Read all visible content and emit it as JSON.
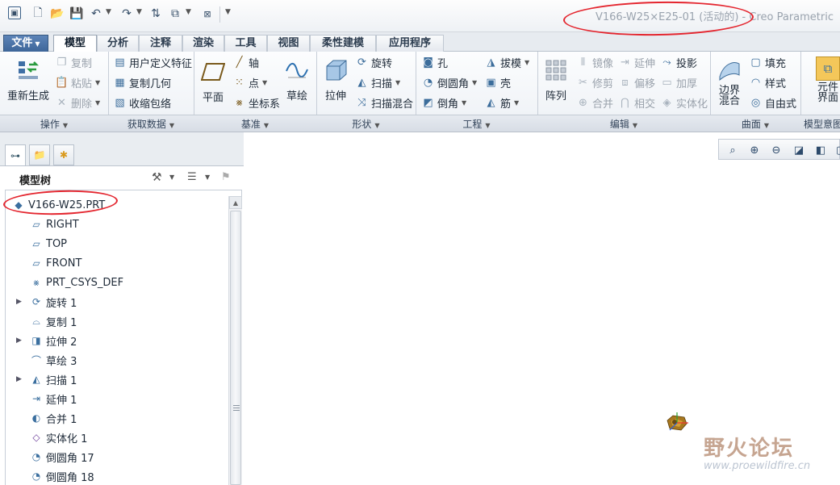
{
  "window": {
    "title": "V166-W25×E25-01 (活动的) - Creo Parametric"
  },
  "tabs": [
    {
      "label": "文件",
      "has_dropdown": true
    },
    {
      "label": "模型",
      "active": true
    },
    {
      "label": "分析"
    },
    {
      "label": "注释"
    },
    {
      "label": "渲染"
    },
    {
      "label": "工具"
    },
    {
      "label": "视图"
    },
    {
      "label": "柔性建模"
    },
    {
      "label": "应用程序"
    }
  ],
  "ribbon": {
    "ops": {
      "regen": "重新生成",
      "copy": "复制",
      "paste": "粘贴",
      "delete": "删除"
    },
    "getdata": {
      "udf": "用户定义特征",
      "copy_geom": "复制几何",
      "shrinkwrap": "收缩包络"
    },
    "datum": {
      "plane": "平面",
      "axis": "轴",
      "point": "点",
      "csys": "坐标系",
      "sketch": "草绘"
    },
    "shape": {
      "extrude": "拉伸",
      "revolve": "旋转",
      "sweep": "扫描",
      "swept_blend": "扫描混合"
    },
    "eng": {
      "hole": "孔",
      "round": "倒圆角",
      "chamfer": "倒角",
      "draft": "拔模",
      "shell": "壳",
      "rib": "筋"
    },
    "edit": {
      "pattern": "阵列",
      "mirror": "镜像",
      "trim": "修剪",
      "merge": "合并",
      "extend": "延伸",
      "offset": "偏移",
      "intersect": "相交",
      "project": "投影",
      "thicken": "加厚",
      "solidify": "实体化"
    },
    "surface": {
      "boundary_line1": "边界",
      "boundary_line2": "混合",
      "fill": "填充",
      "style": "样式",
      "freestyle": "自由式"
    },
    "intent": {
      "component_line1": "元件",
      "component_line2": "界面"
    }
  },
  "groups": {
    "ops": "操作",
    "getdata": "获取数据",
    "datum": "基准",
    "shape": "形状",
    "eng": "工程",
    "edit": "编辑",
    "surface": "曲面",
    "intent": "模型意图"
  },
  "tree": {
    "title": "模型树",
    "items": [
      {
        "label": "V166-W25.PRT",
        "icon": "part-icon",
        "expandable": false
      },
      {
        "label": "RIGHT",
        "icon": "datum-plane-icon",
        "expandable": false
      },
      {
        "label": "TOP",
        "icon": "datum-plane-icon",
        "expandable": false
      },
      {
        "label": "FRONT",
        "icon": "datum-plane-icon",
        "expandable": false
      },
      {
        "label": "PRT_CSYS_DEF",
        "icon": "csys-icon",
        "expandable": false
      },
      {
        "label": "旋转 1",
        "icon": "revolve-icon",
        "expandable": true
      },
      {
        "label": "复制 1",
        "icon": "copy-icon",
        "expandable": false
      },
      {
        "label": "拉伸 2",
        "icon": "extrude-icon",
        "expandable": true
      },
      {
        "label": "草绘 3",
        "icon": "sketch-icon",
        "expandable": false
      },
      {
        "label": "扫描 1",
        "icon": "sweep-icon",
        "expandable": true
      },
      {
        "label": "延伸 1",
        "icon": "extend-icon",
        "expandable": false
      },
      {
        "label": "合并 1",
        "icon": "merge-icon",
        "expandable": false
      },
      {
        "label": "实体化 1",
        "icon": "solidify-icon",
        "expandable": false
      },
      {
        "label": "倒圆角 17",
        "icon": "round-icon",
        "expandable": false
      },
      {
        "label": "倒圆角 18",
        "icon": "round-icon",
        "expandable": false
      }
    ]
  },
  "watermark": {
    "text": "野火论坛",
    "url": "www.proewildfire.cn"
  },
  "annotation_color": "#e4262f"
}
